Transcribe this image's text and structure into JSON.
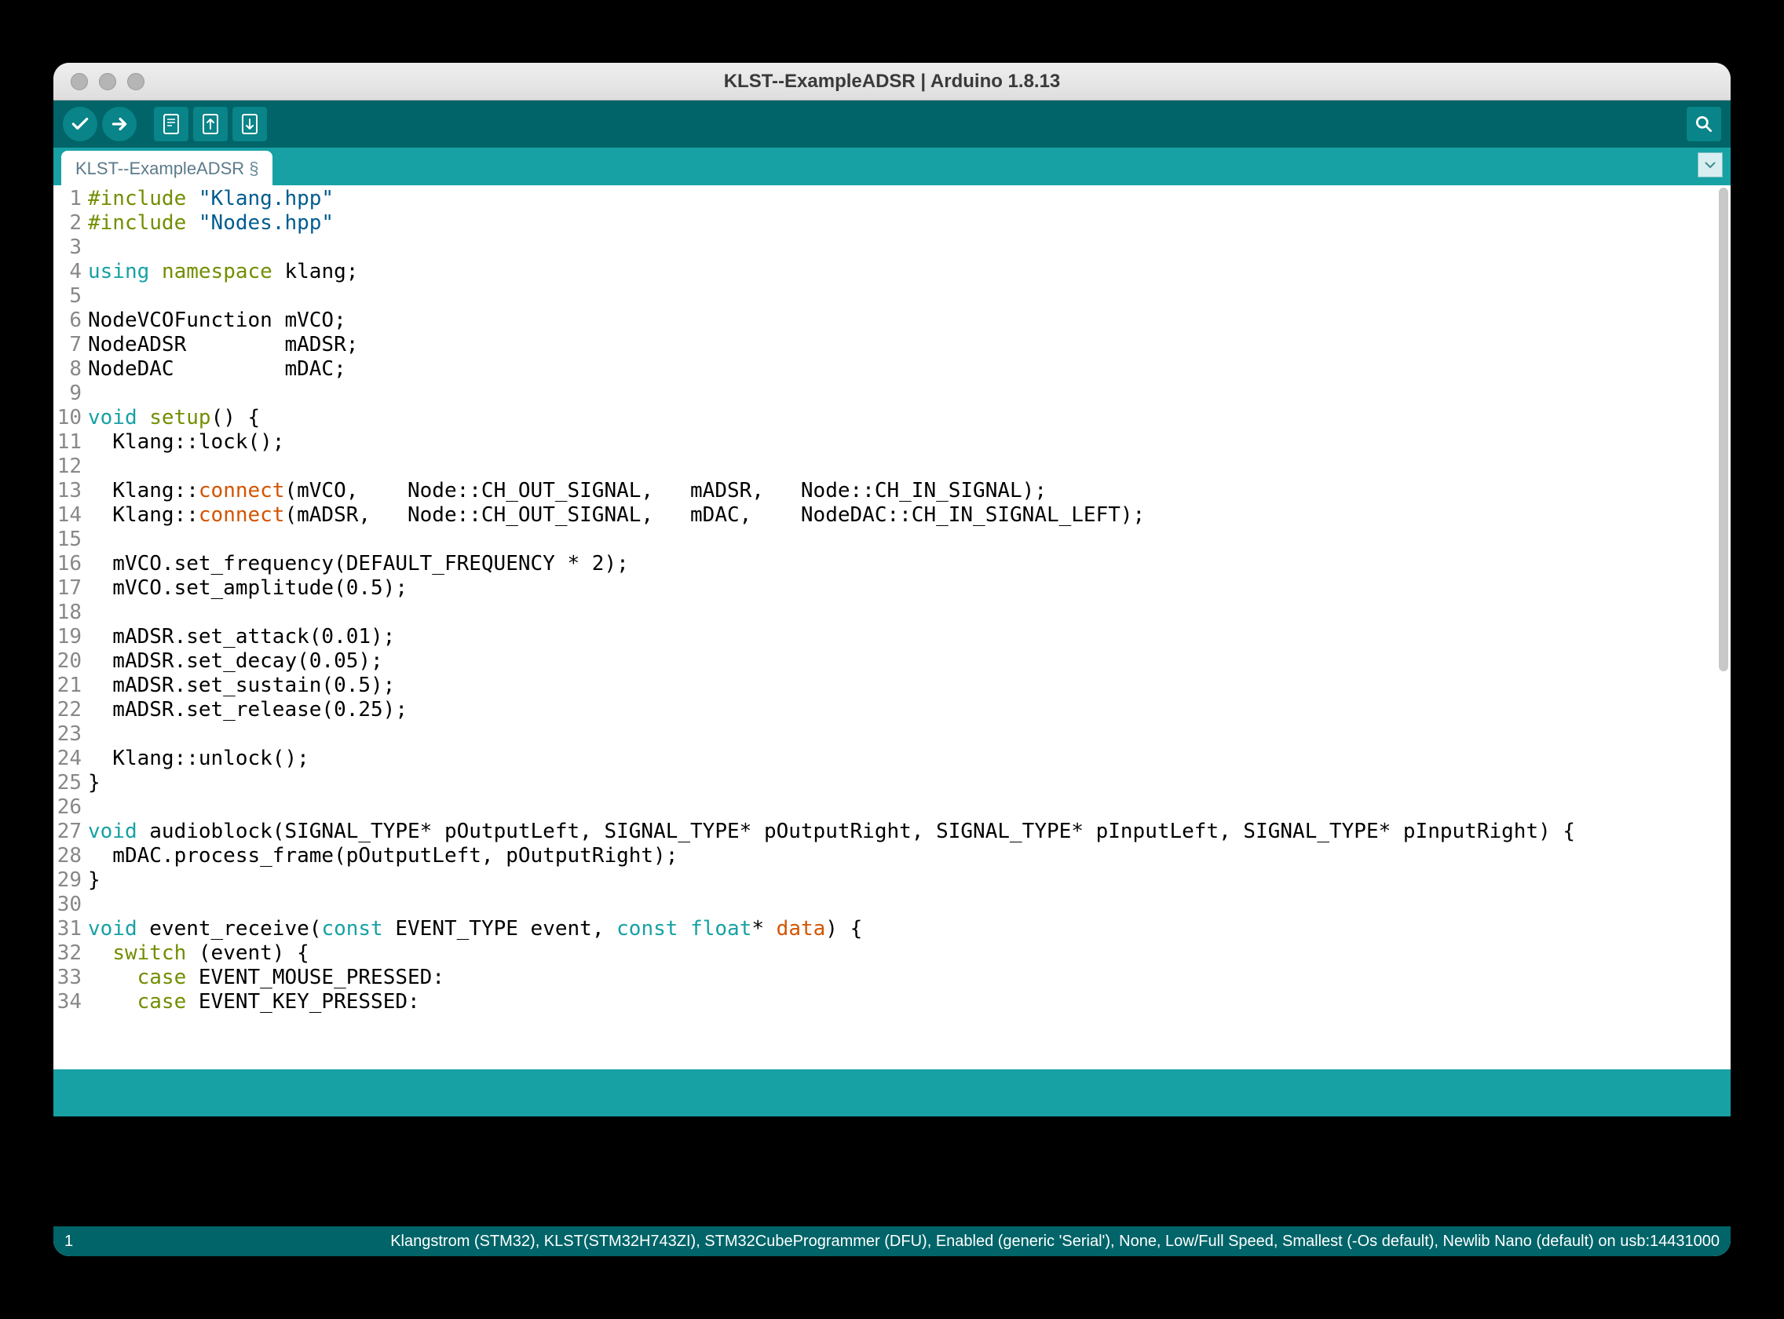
{
  "titlebar": {
    "title": "KLST--ExampleADSR | Arduino 1.8.13"
  },
  "tab": {
    "label": "KLST--ExampleADSR",
    "modified_marker": "§"
  },
  "statusbar": {
    "line_number": "1",
    "board_info": "Klangstrom (STM32), KLST(STM32H743ZI), STM32CubeProgrammer (DFU), Enabled (generic 'Serial'), None, Low/Full Speed, Smallest (-Os default), Newlib Nano (default) on usb:14431000"
  },
  "code_lines": [
    {
      "n": 1,
      "tokens": [
        {
          "c": "pre",
          "t": "#include "
        },
        {
          "c": "str",
          "t": "\"Klang.hpp\""
        }
      ]
    },
    {
      "n": 2,
      "tokens": [
        {
          "c": "pre",
          "t": "#include "
        },
        {
          "c": "str",
          "t": "\"Nodes.hpp\""
        }
      ]
    },
    {
      "n": 3,
      "tokens": []
    },
    {
      "n": 4,
      "tokens": [
        {
          "c": "kw",
          "t": "using"
        },
        {
          "c": "",
          "t": " "
        },
        {
          "c": "pre",
          "t": "namespace"
        },
        {
          "c": "",
          "t": " klang;"
        }
      ]
    },
    {
      "n": 5,
      "tokens": []
    },
    {
      "n": 6,
      "tokens": [
        {
          "c": "",
          "t": "NodeVCOFunction mVCO;"
        }
      ]
    },
    {
      "n": 7,
      "tokens": [
        {
          "c": "",
          "t": "NodeADSR        mADSR;"
        }
      ]
    },
    {
      "n": 8,
      "tokens": [
        {
          "c": "",
          "t": "NodeDAC         mDAC;"
        }
      ]
    },
    {
      "n": 9,
      "tokens": []
    },
    {
      "n": 10,
      "tokens": [
        {
          "c": "kw",
          "t": "void"
        },
        {
          "c": "",
          "t": " "
        },
        {
          "c": "pre",
          "t": "setup"
        },
        {
          "c": "",
          "t": "() {"
        }
      ]
    },
    {
      "n": 11,
      "tokens": [
        {
          "c": "",
          "t": "  Klang::lock();"
        }
      ]
    },
    {
      "n": 12,
      "tokens": []
    },
    {
      "n": 13,
      "tokens": [
        {
          "c": "",
          "t": "  Klang::"
        },
        {
          "c": "fn",
          "t": "connect"
        },
        {
          "c": "",
          "t": "(mVCO,    Node::CH_OUT_SIGNAL,   mADSR,   Node::CH_IN_SIGNAL);"
        }
      ]
    },
    {
      "n": 14,
      "tokens": [
        {
          "c": "",
          "t": "  Klang::"
        },
        {
          "c": "fn",
          "t": "connect"
        },
        {
          "c": "",
          "t": "(mADSR,   Node::CH_OUT_SIGNAL,   mDAC,    NodeDAC::CH_IN_SIGNAL_LEFT);"
        }
      ]
    },
    {
      "n": 15,
      "tokens": []
    },
    {
      "n": 16,
      "tokens": [
        {
          "c": "",
          "t": "  mVCO.set_frequency(DEFAULT_FREQUENCY * 2);"
        }
      ]
    },
    {
      "n": 17,
      "tokens": [
        {
          "c": "",
          "t": "  mVCO.set_amplitude(0.5);"
        }
      ]
    },
    {
      "n": 18,
      "tokens": []
    },
    {
      "n": 19,
      "tokens": [
        {
          "c": "",
          "t": "  mADSR.set_attack(0.01);"
        }
      ]
    },
    {
      "n": 20,
      "tokens": [
        {
          "c": "",
          "t": "  mADSR.set_decay(0.05);"
        }
      ]
    },
    {
      "n": 21,
      "tokens": [
        {
          "c": "",
          "t": "  mADSR.set_sustain(0.5);"
        }
      ]
    },
    {
      "n": 22,
      "tokens": [
        {
          "c": "",
          "t": "  mADSR.set_release(0.25);"
        }
      ]
    },
    {
      "n": 23,
      "tokens": []
    },
    {
      "n": 24,
      "tokens": [
        {
          "c": "",
          "t": "  Klang::unlock();"
        }
      ]
    },
    {
      "n": 25,
      "tokens": [
        {
          "c": "",
          "t": "}"
        }
      ]
    },
    {
      "n": 26,
      "tokens": []
    },
    {
      "n": 27,
      "tokens": [
        {
          "c": "kw",
          "t": "void"
        },
        {
          "c": "",
          "t": " audioblock(SIGNAL_TYPE* pOutputLeft, SIGNAL_TYPE* pOutputRight, SIGNAL_TYPE* pInputLeft, SIGNAL_TYPE* pInputRight) {"
        }
      ]
    },
    {
      "n": 28,
      "tokens": [
        {
          "c": "",
          "t": "  mDAC.process_frame(pOutputLeft, pOutputRight);"
        }
      ]
    },
    {
      "n": 29,
      "tokens": [
        {
          "c": "",
          "t": "}"
        }
      ]
    },
    {
      "n": 30,
      "tokens": []
    },
    {
      "n": 31,
      "tokens": [
        {
          "c": "kw",
          "t": "void"
        },
        {
          "c": "",
          "t": " event_receive("
        },
        {
          "c": "kw",
          "t": "const"
        },
        {
          "c": "",
          "t": " EVENT_TYPE event, "
        },
        {
          "c": "kw",
          "t": "const"
        },
        {
          "c": "",
          "t": " "
        },
        {
          "c": "kw",
          "t": "float"
        },
        {
          "c": "",
          "t": "* "
        },
        {
          "c": "fn",
          "t": "data"
        },
        {
          "c": "",
          "t": ") {"
        }
      ]
    },
    {
      "n": 32,
      "tokens": [
        {
          "c": "",
          "t": "  "
        },
        {
          "c": "pre",
          "t": "switch"
        },
        {
          "c": "",
          "t": " (event) {"
        }
      ]
    },
    {
      "n": 33,
      "tokens": [
        {
          "c": "",
          "t": "    "
        },
        {
          "c": "pre",
          "t": "case"
        },
        {
          "c": "",
          "t": " EVENT_MOUSE_PRESSED:"
        }
      ]
    },
    {
      "n": 34,
      "tokens": [
        {
          "c": "",
          "t": "    "
        },
        {
          "c": "pre",
          "t": "case"
        },
        {
          "c": "",
          "t": " EVENT_KEY_PRESSED:"
        }
      ]
    }
  ]
}
